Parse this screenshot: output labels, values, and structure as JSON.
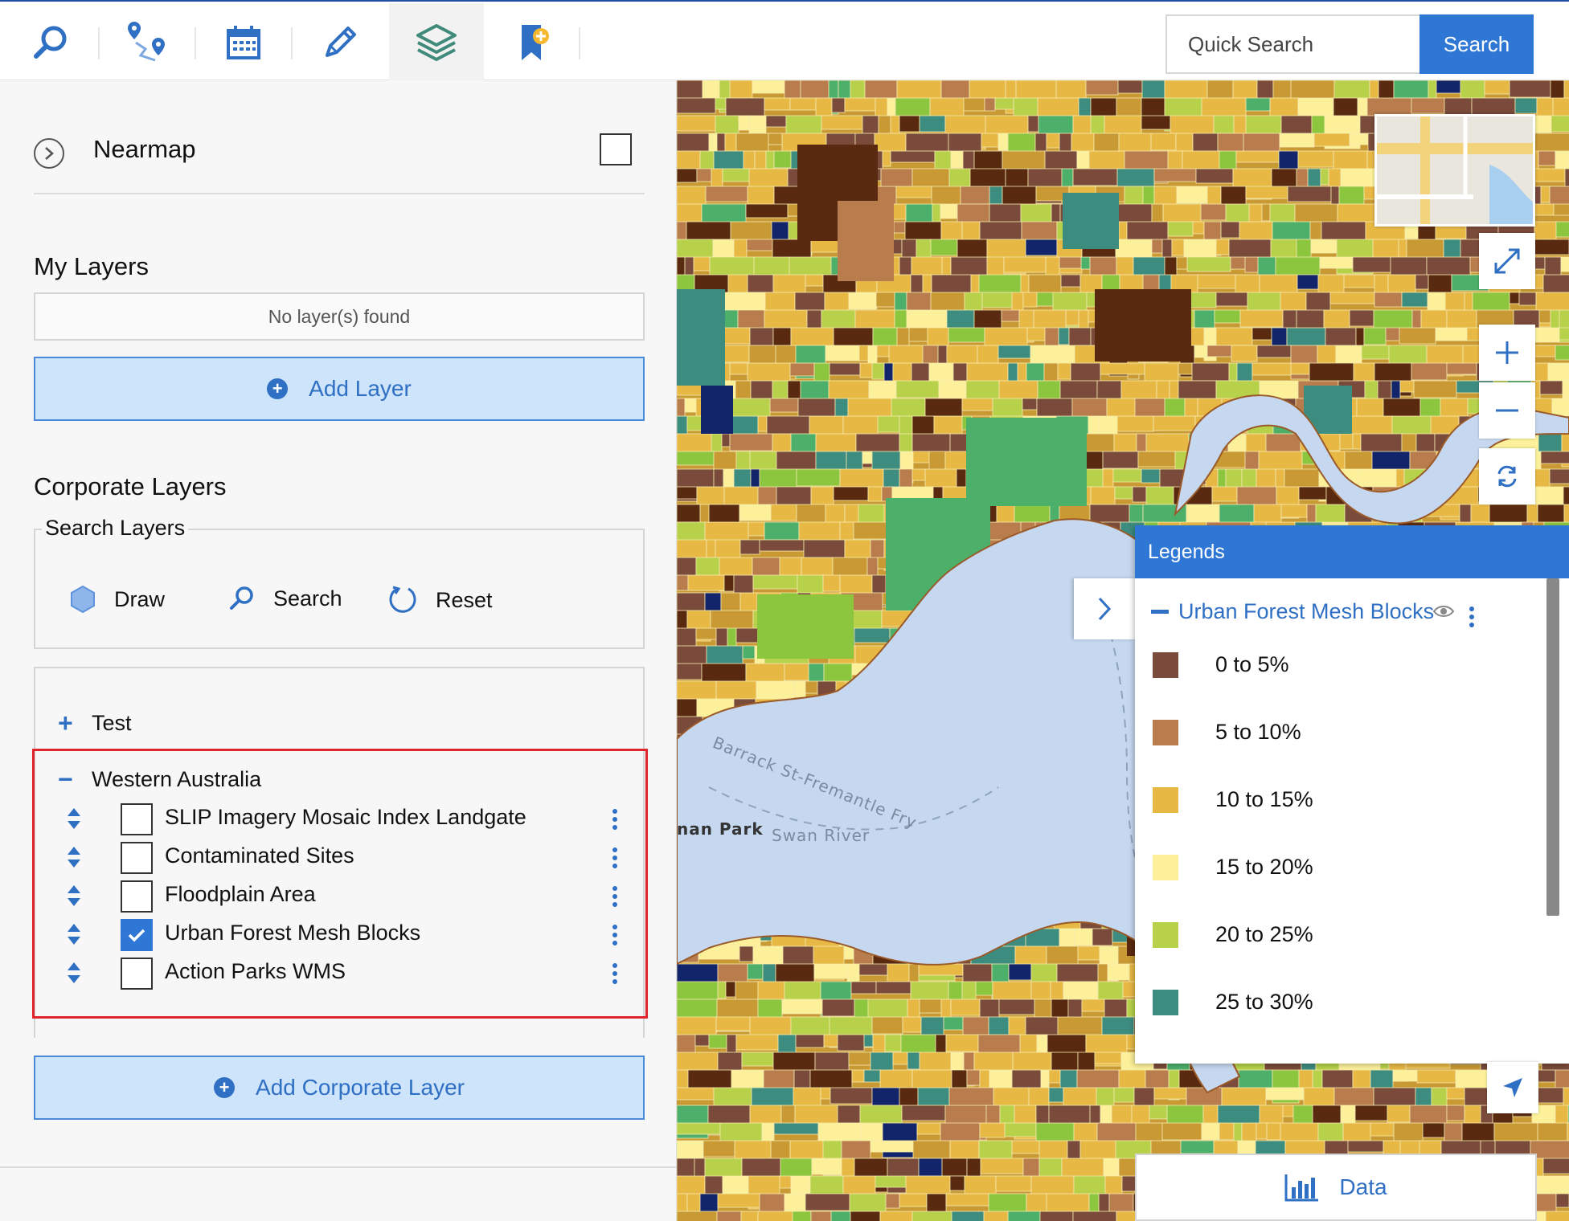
{
  "toolbar": {
    "tools": [
      {
        "name": "search-tool",
        "icon": "magnifier-icon"
      },
      {
        "name": "route-tool",
        "icon": "route-pins-icon"
      },
      {
        "name": "calendar-tool",
        "icon": "calendar-icon"
      },
      {
        "name": "draw-tool",
        "icon": "pencil-icon"
      },
      {
        "name": "layers-tool",
        "icon": "layers-icon",
        "active": true
      },
      {
        "name": "bookmark-tool",
        "icon": "bookmark-icon"
      }
    ],
    "quick_search_placeholder": "Quick Search",
    "search_button": "Search"
  },
  "panel": {
    "nearmap": {
      "title": "Nearmap",
      "checked": false
    },
    "my_layers": {
      "title": "My Layers",
      "empty_text": "No layer(s) found",
      "add_button": "Add Layer"
    },
    "corporate_layers": {
      "title": "Corporate Layers",
      "search_layers": {
        "legend": "Search Layers",
        "draw": "Draw",
        "search": "Search",
        "reset": "Reset"
      },
      "groups": [
        {
          "sign": "+",
          "label": "Test",
          "expanded": false
        },
        {
          "sign": "−",
          "label": "Western Australia",
          "expanded": true
        }
      ],
      "layers": [
        {
          "label": "SLIP Imagery Mosaic Index Landgate",
          "checked": false
        },
        {
          "label": "Contaminated Sites",
          "checked": false
        },
        {
          "label": "Floodplain Area",
          "checked": false
        },
        {
          "label": "Urban Forest Mesh Blocks",
          "checked": true
        },
        {
          "label": "Action Parks WMS",
          "checked": false
        }
      ],
      "add_button": "Add Corporate Layer"
    }
  },
  "map": {
    "labels": {
      "ferry": "Barrack St-Fremantle Fry",
      "river": "Swan River",
      "park": "nan Park"
    },
    "legend": {
      "header": "Legends",
      "layer_title": "Urban Forest Mesh Blocks",
      "items": [
        {
          "label": "0 to 5%",
          "color": "#7a4a3a"
        },
        {
          "label": "5 to 10%",
          "color": "#b97c4d"
        },
        {
          "label": "10 to 15%",
          "color": "#e8b845"
        },
        {
          "label": "15 to 20%",
          "color": "#fcf19a"
        },
        {
          "label": "20 to 25%",
          "color": "#b7d24a"
        },
        {
          "label": "25 to 30%",
          "color": "#3d8c80"
        }
      ]
    },
    "data_button": "Data",
    "colors": {
      "water": "#c6d8ef",
      "accent": "#2f77d4",
      "highlight": "#e0242b"
    }
  }
}
